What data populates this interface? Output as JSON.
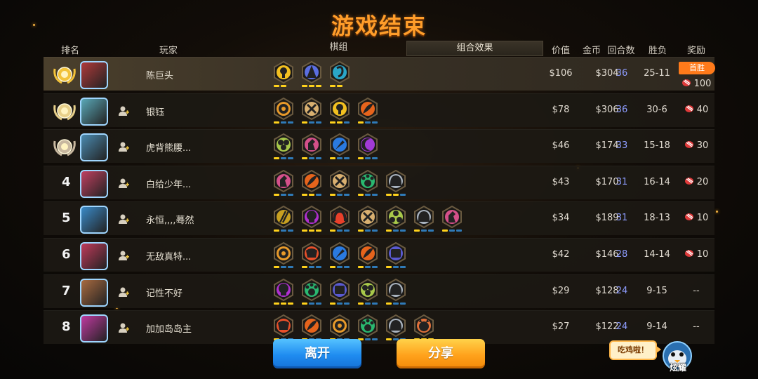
{
  "title": "游戏结束",
  "headers": {
    "rank": "排名",
    "player": "玩家",
    "tabs": [
      "棋组",
      "组合效果"
    ],
    "active_tab_index": 1,
    "value": "价值",
    "gold": "金币",
    "rounds": "回合数",
    "win_loss": "胜负",
    "reward": "奖励"
  },
  "colors": {
    "title": "#ff9d2a",
    "rounds": "#8e9dff",
    "bar_active": "#ffd21c",
    "bar_inactive": "#2f7ab8",
    "first_badge": "#ff7a1a"
  },
  "players": [
    {
      "rank": "",
      "medal": "gold-laurel-medal-icon",
      "avatar_color": "#b03a3a",
      "name": "陈巨头",
      "add_friend": false,
      "traits": [
        {
          "color": "#f2c020",
          "icon": "keyhole",
          "pips": [
            1,
            1
          ]
        },
        {
          "color": "#5b6ee0",
          "icon": "wizard",
          "pips": [
            1,
            1,
            1
          ]
        },
        {
          "color": "#2aa6c8",
          "icon": "hook",
          "pips": [
            1,
            1
          ]
        }
      ],
      "value": "$106",
      "gold": "$304",
      "rounds": "36",
      "win_loss": "25-11",
      "reward_badge": "首胜",
      "reward": "100"
    },
    {
      "rank": "",
      "medal": "silver-laurel-medal-icon",
      "avatar_color": "#5aa8b8",
      "name": "银钰",
      "add_friend": true,
      "traits": [
        {
          "color": "#e89a2a",
          "icon": "gear",
          "pips": [
            1,
            0,
            0
          ]
        },
        {
          "color": "#d9b070",
          "icon": "axe",
          "pips": [
            1,
            0,
            0
          ]
        },
        {
          "color": "#f2c020",
          "icon": "keyhole",
          "pips": [
            1,
            1,
            0
          ]
        },
        {
          "color": "#e6641c",
          "icon": "feather",
          "pips": [
            1,
            0,
            0
          ]
        }
      ],
      "value": "$78",
      "gold": "$306",
      "rounds": "36",
      "win_loss": "30-6",
      "reward": "40"
    },
    {
      "rank": "",
      "medal": "bronze-laurel-medal-icon",
      "avatar_color": "#4a8ab0",
      "name": "虎背熊腰...",
      "add_friend": true,
      "traits": [
        {
          "color": "#a8c84a",
          "icon": "clover",
          "pips": [
            1,
            0,
            0
          ]
        },
        {
          "color": "#d4508a",
          "icon": "knight",
          "pips": [
            1,
            0,
            0
          ]
        },
        {
          "color": "#2a7ae0",
          "icon": "carrot",
          "pips": [
            1,
            0,
            0
          ]
        },
        {
          "color": "#a23ad6",
          "icon": "crescent",
          "pips": [
            1,
            0,
            0
          ]
        }
      ],
      "value": "$46",
      "gold": "$174",
      "rounds": "33",
      "win_loss": "15-18",
      "reward": "30"
    },
    {
      "rank": "4",
      "medal": "",
      "avatar_color": "#c04060",
      "name": "白给少年...",
      "add_friend": true,
      "traits": [
        {
          "color": "#d4508a",
          "icon": "knight",
          "pips": [
            1,
            0,
            0
          ]
        },
        {
          "color": "#e6641c",
          "icon": "feather",
          "pips": [
            1,
            1,
            0
          ]
        },
        {
          "color": "#d9b070",
          "icon": "axe",
          "pips": [
            1,
            0,
            0
          ]
        },
        {
          "color": "#2ab870",
          "icon": "paw",
          "pips": [
            1,
            0,
            0
          ]
        },
        {
          "color": "#aab4c0",
          "icon": "helmet",
          "pips": [
            1,
            1,
            0
          ]
        }
      ],
      "value": "$43",
      "gold": "$170",
      "rounds": "31",
      "win_loss": "16-14",
      "reward": "20"
    },
    {
      "rank": "5",
      "medal": "",
      "avatar_color": "#3a8ac8",
      "name": "永恒,,,,蓦然",
      "add_friend": true,
      "traits": [
        {
          "color": "#c8a020",
          "icon": "tridents",
          "pips": [
            1,
            0,
            0
          ]
        },
        {
          "color": "#b030d0",
          "icon": "skull",
          "pips": [
            1,
            1,
            1
          ]
        },
        {
          "color": "#e8402a",
          "icon": "arch",
          "pips": [
            1,
            0,
            0
          ]
        },
        {
          "color": "#d9b070",
          "icon": "axe",
          "pips": [
            1,
            0,
            0
          ]
        },
        {
          "color": "#a8c84a",
          "icon": "trio",
          "pips": [
            1,
            0,
            0
          ]
        },
        {
          "color": "#aab4c0",
          "icon": "helmet",
          "pips": [
            1,
            0,
            0
          ]
        },
        {
          "color": "#d4508a",
          "icon": "knight",
          "pips": [
            1,
            0,
            0
          ]
        }
      ],
      "value": "$34",
      "gold": "$189",
      "rounds": "31",
      "win_loss": "18-13",
      "reward": "10"
    },
    {
      "rank": "6",
      "medal": "",
      "avatar_color": "#c03a5a",
      "name": "无敌真特...",
      "add_friend": true,
      "traits": [
        {
          "color": "#e89a2a",
          "icon": "gear",
          "pips": [
            1,
            0,
            0
          ]
        },
        {
          "color": "#e8502a",
          "icon": "mask",
          "pips": [
            1,
            0,
            0
          ]
        },
        {
          "color": "#2a7ae0",
          "icon": "carrot",
          "pips": [
            1,
            0,
            0
          ]
        },
        {
          "color": "#e6641c",
          "icon": "feather",
          "pips": [
            1,
            0,
            0
          ]
        },
        {
          "color": "#5a5ad0",
          "icon": "robot",
          "pips": [
            1,
            0,
            0
          ]
        }
      ],
      "value": "$42",
      "gold": "$146",
      "rounds": "28",
      "win_loss": "14-14",
      "reward": "10"
    },
    {
      "rank": "7",
      "medal": "",
      "avatar_color": "#a86a40",
      "name": "记性不好",
      "add_friend": true,
      "traits": [
        {
          "color": "#b030d0",
          "icon": "skull",
          "pips": [
            1,
            1,
            1
          ]
        },
        {
          "color": "#2ab870",
          "icon": "paw",
          "pips": [
            1,
            0,
            0
          ]
        },
        {
          "color": "#5a5ad0",
          "icon": "robot",
          "pips": [
            1,
            0,
            0
          ]
        },
        {
          "color": "#a8c84a",
          "icon": "clover",
          "pips": [
            1,
            0,
            0
          ]
        },
        {
          "color": "#aab4c0",
          "icon": "helmet",
          "pips": [
            1,
            0,
            0
          ]
        }
      ],
      "value": "$29",
      "gold": "$128",
      "rounds": "24",
      "win_loss": "9-15",
      "reward": "--"
    },
    {
      "rank": "8",
      "medal": "",
      "avatar_color": "#c03aa0",
      "name": "加加岛岛主",
      "add_friend": true,
      "traits": [
        {
          "color": "#e8502a",
          "icon": "mask",
          "pips": [
            1,
            0,
            0
          ]
        },
        {
          "color": "#e6641c",
          "icon": "feather",
          "pips": [
            1,
            0,
            0
          ]
        },
        {
          "color": "#e89a2a",
          "icon": "gear",
          "pips": [
            1,
            0,
            0
          ]
        },
        {
          "color": "#2ab870",
          "icon": "paw",
          "pips": [
            1,
            0,
            0
          ]
        },
        {
          "color": "#aab4c0",
          "icon": "helmet",
          "pips": [
            1,
            0,
            0
          ]
        },
        {
          "color": "#e0703a",
          "icon": "demon",
          "pips": [
            1,
            1,
            1
          ]
        }
      ],
      "value": "$27",
      "gold": "$122",
      "rounds": "24",
      "win_loss": "9-14",
      "reward": "--"
    }
  ],
  "buttons": {
    "leave": "离开",
    "share": "分享"
  },
  "chat_bubble": "吃鸡啦！",
  "show_off_label": "炫耀"
}
